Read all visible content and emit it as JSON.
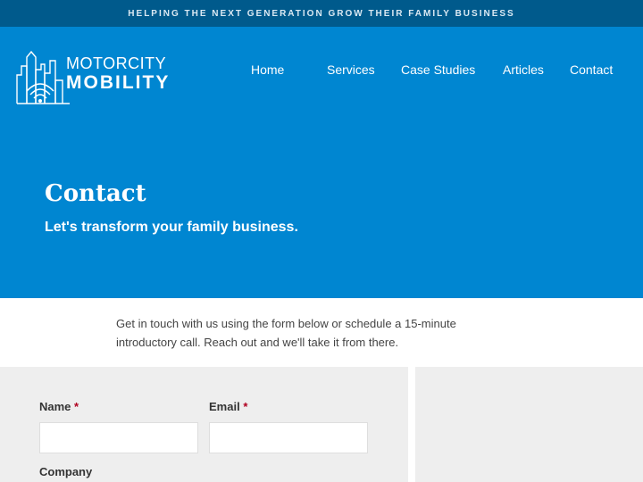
{
  "topbar": {
    "tagline": "HELPING THE NEXT GENERATION GROW THEIR FAMILY BUSINESS"
  },
  "logo": {
    "line1": "MOTORCITY",
    "line2": "MOBILITY"
  },
  "nav": {
    "items": [
      "Home",
      "Services",
      "Case Studies",
      "Articles",
      "Contact"
    ]
  },
  "hero": {
    "title": "Contact",
    "subtitle": "Let's transform your family business."
  },
  "intro": {
    "text": "Get in touch with us using the form below or schedule a 15-minute introductory call. Reach out and we'll take it from there."
  },
  "form": {
    "name_label": "Name",
    "email_label": "Email",
    "company_label": "Company",
    "required_marker": "*",
    "name_value": "",
    "email_value": ""
  },
  "colors": {
    "topbar": "#005a8c",
    "header": "#0086d1",
    "panel": "#eeeeee",
    "required": "#b00020"
  },
  "icons": {
    "logo": "city-skyline-wifi-logo"
  }
}
